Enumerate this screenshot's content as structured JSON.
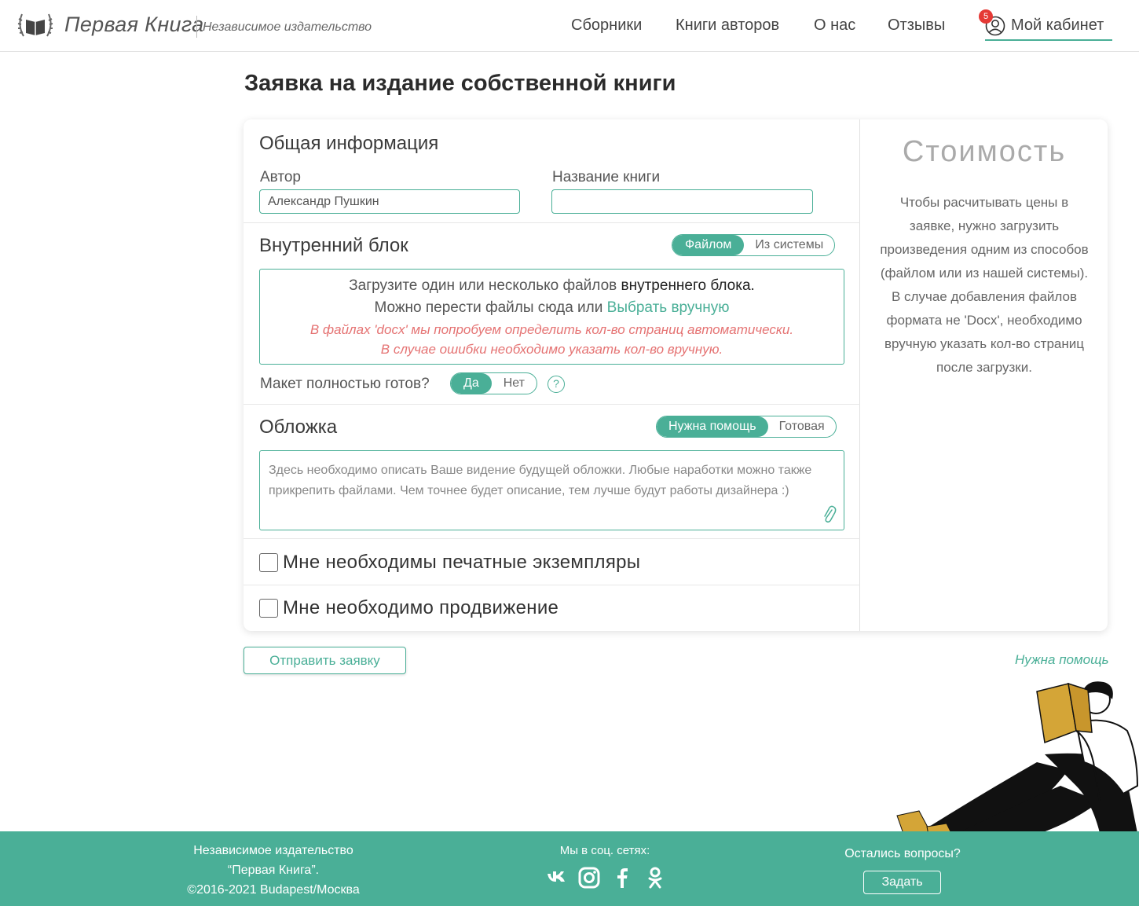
{
  "header": {
    "brand": "Первая Книга",
    "tagline": "Независимое издательство",
    "nav": [
      "Сборники",
      "Книги авторов",
      "О нас",
      "Отзывы"
    ],
    "cabinet_label": "Мой кабинет",
    "cabinet_badge": "5"
  },
  "page": {
    "title": "Заявка на издание собственной книги"
  },
  "general": {
    "title": "Общая информация",
    "author_label": "Автор",
    "author_value": "Александр Пушкин",
    "book_label": "Название книги",
    "book_value": ""
  },
  "inner_block": {
    "title": "Внутренний блок",
    "toggle": [
      "Файлом",
      "Из системы"
    ],
    "toggle_active": "Файлом",
    "drop_line1_pre": "Загрузите один или несколько файлов ",
    "drop_line1_bold": "внутреннего блока.",
    "drop_line2_pre": "Можно перести файлы сюда или ",
    "drop_line2_link": "Выбрать вручную",
    "warn1": "В файлах 'docx' мы попробуем определить кол-во страниц автоматически.",
    "warn2": "В случае ошибки необходимо указать кол-во вручную.",
    "layout_question": "Макет полностью готов?",
    "layout_toggle": [
      "Да",
      "Нет"
    ],
    "layout_active": "Да",
    "help": "?"
  },
  "cover": {
    "title": "Обложка",
    "toggle": [
      "Нужна помощь",
      "Готовая"
    ],
    "toggle_active": "Нужна помощь",
    "placeholder": "Здесь необходимо описать Ваше видение будущей обложки. Любые наработки можно также прикрепить файлами. Чем точнее будет описание, тем лучше будут работы дизайнера :)"
  },
  "options": {
    "print_label": "Мне необходимы печатные экземпляры",
    "print_checked": false,
    "promo_label": "Мне необходимо продвижение",
    "promo_checked": false
  },
  "cost": {
    "title": "Стоимость",
    "text": "Чтобы расчитывать цены в заявке, нужно загрузить произведения одним из способов (файлом или из нашей системы). В случае добавления файлов формата не 'Docx', необходимо вручную указать кол-во страниц после загрузки."
  },
  "actions": {
    "submit": "Отправить заявку",
    "need_help": "Нужна помощь"
  },
  "footer": {
    "line1": "Независимое издательство",
    "line2": "“Первая Книга”.",
    "line3": "©2016-2021 Budapest/Москва",
    "social_title": "Мы в соц. сетях:",
    "social_icons": [
      "vk-icon",
      "instagram-icon",
      "facebook-icon",
      "odnoklassniki-icon"
    ],
    "questions": "Остались вопросы?",
    "ask": "Задать"
  },
  "colors": {
    "accent": "#4aaf97",
    "warning": "#e57373",
    "badge": "#e53935"
  }
}
